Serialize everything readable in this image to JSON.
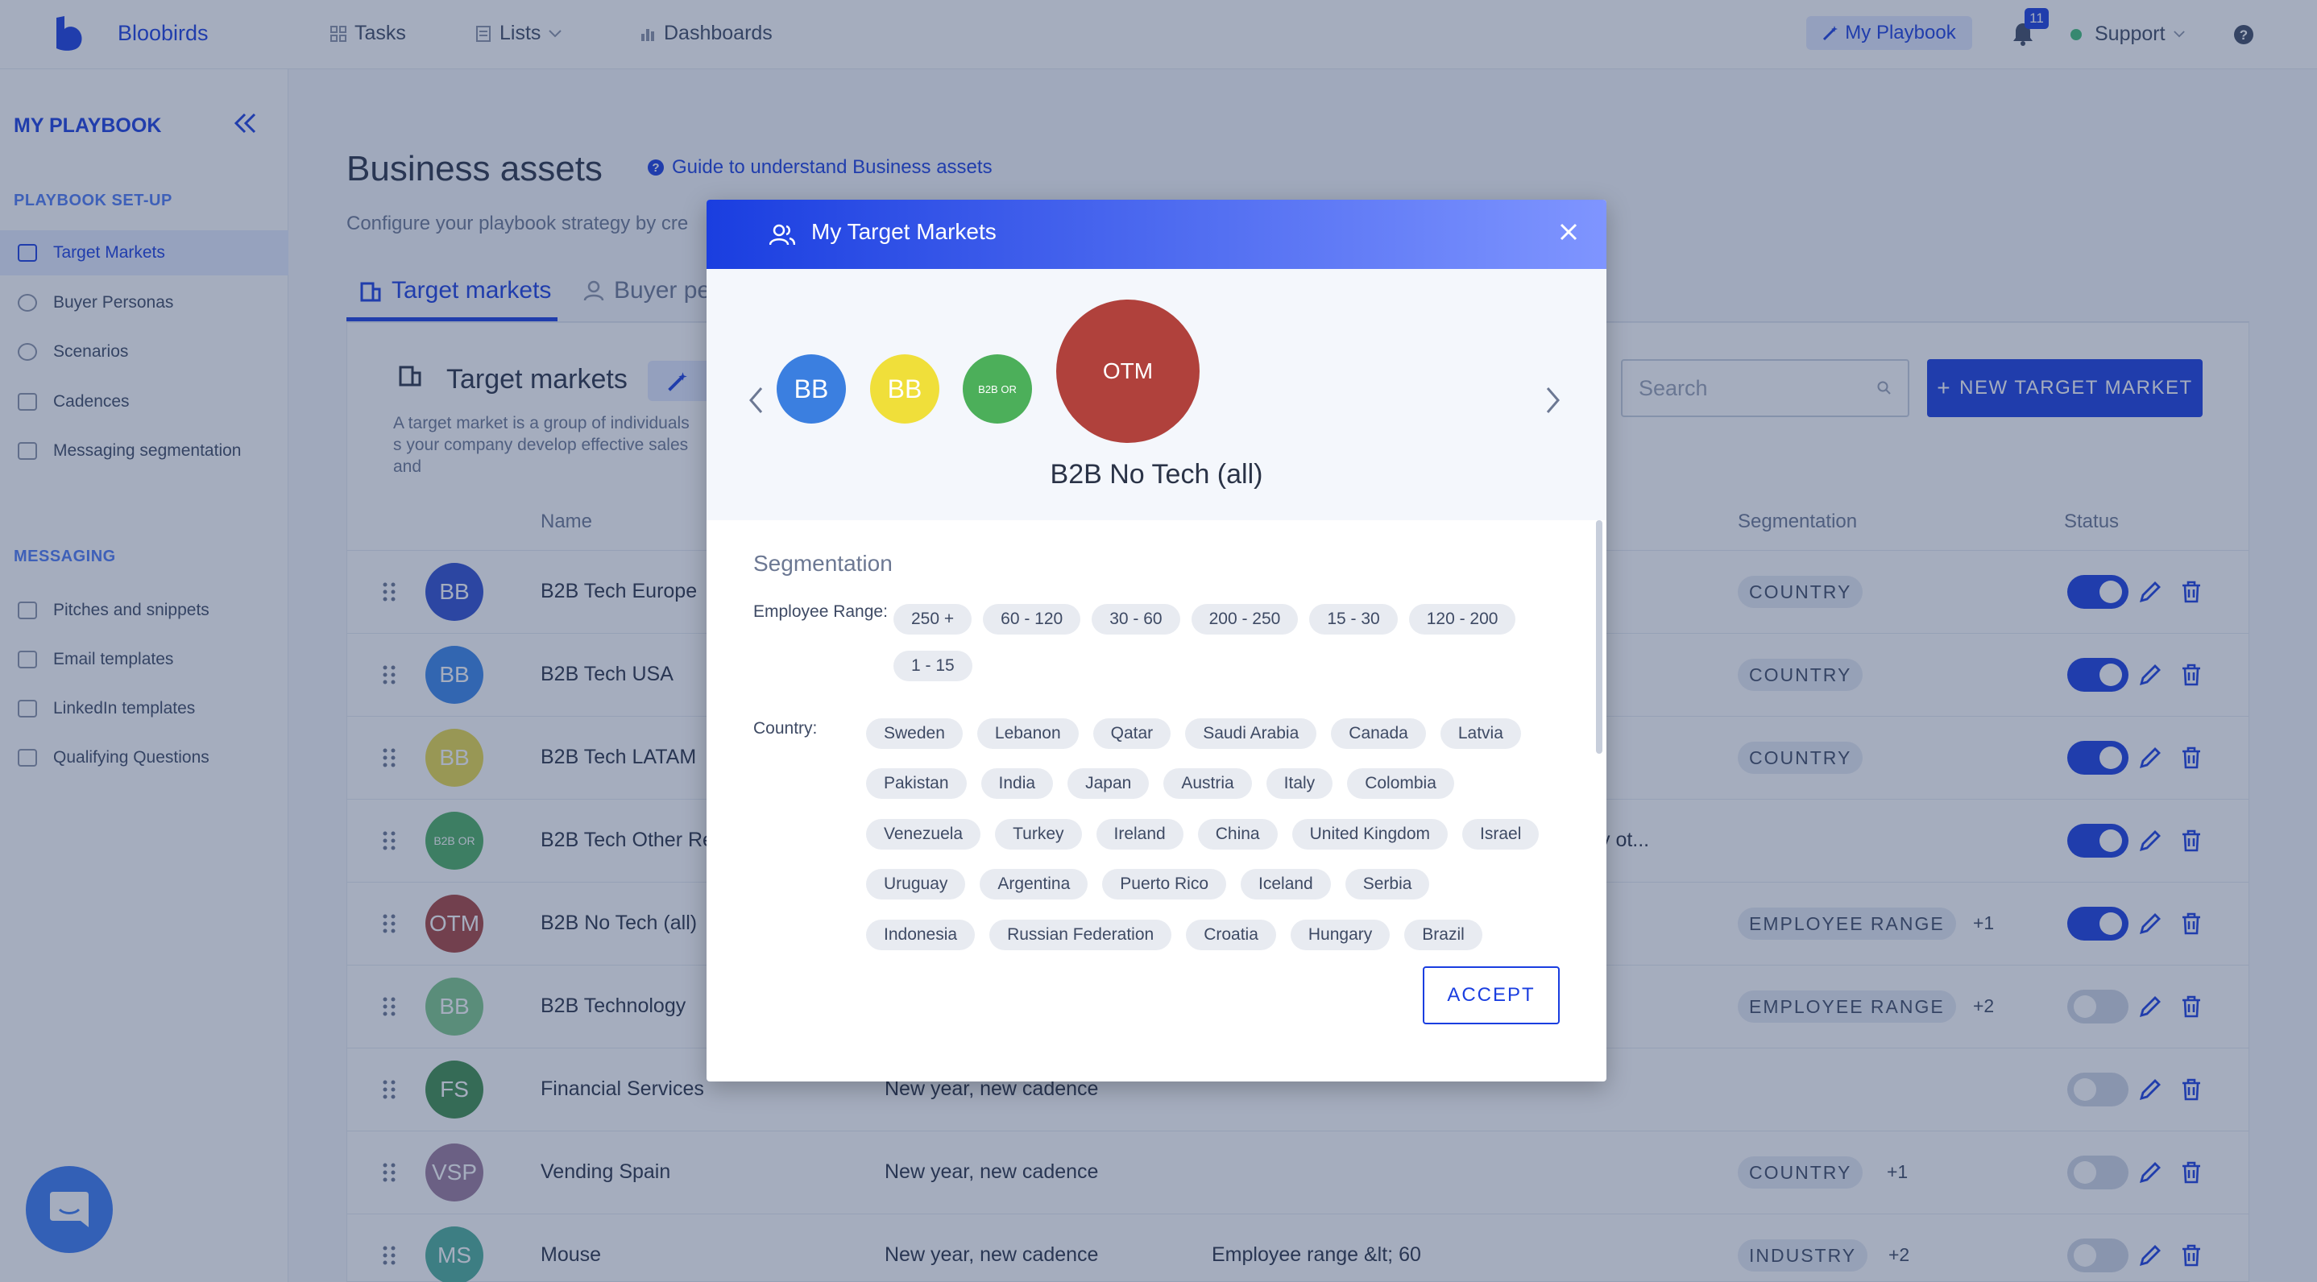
{
  "app": {
    "brand": "Bloobirds",
    "nav": {
      "tasks": "Tasks",
      "lists": "Lists",
      "dashboards": "Dashboards"
    },
    "my_playbook": "My Playbook",
    "notifications_count": "11",
    "support": "Support"
  },
  "sidebar": {
    "title": "MY PLAYBOOK",
    "section1": "PLAYBOOK SET-UP",
    "setup_items": [
      "Target Markets",
      "Buyer Personas",
      "Scenarios",
      "Cadences",
      "Messaging segmentation"
    ],
    "section2": "MESSAGING",
    "messaging_items": [
      "Pitches and snippets",
      "Email templates",
      "LinkedIn templates",
      "Qualifying Questions"
    ]
  },
  "main": {
    "title": "Business assets",
    "guide_link": "Guide to understand Business assets",
    "subtitle": "Configure your playbook strategy by cre",
    "tabs": [
      "Target markets",
      "Buyer pe"
    ],
    "panel_title": "Target markets",
    "panel_desc": "A target market is a group of individuals s your company develop effective sales and",
    "search_placeholder": "Search",
    "new_button": "NEW TARGET MARKET",
    "columns": {
      "name": "Name",
      "segmentation": "Segmentation",
      "status": "Status"
    },
    "rows": [
      {
        "initials": "BB",
        "name": "B2B Tech Europe",
        "cadence": "",
        "extra": "",
        "chip": "COUNTRY",
        "more": "",
        "enabled": true,
        "color": "#2f4fcf"
      },
      {
        "initials": "BB",
        "name": "B2B Tech USA",
        "cadence": "",
        "extra": "",
        "chip": "COUNTRY",
        "more": "",
        "enabled": true,
        "color": "#3a86e8"
      },
      {
        "initials": "BB",
        "name": "B2B Tech LATAM",
        "cadence": "",
        "extra": "",
        "chip": "COUNTRY",
        "more": "",
        "enabled": true,
        "color": "#e8d94a"
      },
      {
        "initials": "B2B OR",
        "name": "B2B Tech Other Re",
        "cadence": "",
        "extra": "y ot...",
        "chip": "",
        "more": "",
        "enabled": true,
        "color": "#4caf62"
      },
      {
        "initials": "OTM",
        "name": "B2B No Tech (all)",
        "cadence": "",
        "extra": "",
        "chip": "EMPLOYEE RANGE",
        "more": "+1",
        "enabled": true,
        "color": "#a8443e"
      },
      {
        "initials": "BB",
        "name": "B2B Technology",
        "cadence": "",
        "extra": "",
        "chip": "EMPLOYEE RANGE",
        "more": "+2",
        "enabled": false,
        "color": "#7fc88a"
      },
      {
        "initials": "FS",
        "name": "Financial Services",
        "cadence": "New year, new cadence",
        "extra": "",
        "chip": "",
        "more": "",
        "enabled": false,
        "color": "#3f8d4c"
      },
      {
        "initials": "VSP",
        "name": "Vending Spain",
        "cadence": "New year, new cadence",
        "extra": "",
        "chip": "COUNTRY",
        "more": "+1",
        "enabled": false,
        "color": "#9b7a9b"
      },
      {
        "initials": "MS",
        "name": "Mouse",
        "cadence": "New year, new cadence",
        "extra": "Employee range &lt; 60",
        "chip": "INDUSTRY",
        "more": "+2",
        "enabled": false,
        "color": "#4caf9a"
      }
    ]
  },
  "modal": {
    "title": "My Target Markets",
    "carousel": [
      {
        "initials": "BB",
        "color": "#3b7fe0"
      },
      {
        "initials": "BB",
        "color": "#f0df3a"
      },
      {
        "initials": "B2B OR",
        "color": "#4caf5a"
      },
      {
        "initials": "OTM",
        "color": "#b0413c"
      }
    ],
    "selected_name": "B2B No Tech (all)",
    "segmentation_title": "Segmentation",
    "employee_range_label": "Employee Range:",
    "employee_ranges": [
      "250 +",
      "60 - 120",
      "30 - 60",
      "200 - 250",
      "15 - 30",
      "120 - 200",
      "1 - 15"
    ],
    "country_label": "Country:",
    "countries": [
      "Sweden",
      "Lebanon",
      "Qatar",
      "Saudi Arabia",
      "Canada",
      "Latvia",
      "Pakistan",
      "India",
      "Japan",
      "Austria",
      "Italy",
      "Colombia",
      "Venezuela",
      "Turkey",
      "Ireland",
      "China",
      "United Kingdom",
      "Israel",
      "Uruguay",
      "Argentina",
      "Puerto Rico",
      "Iceland",
      "Serbia",
      "Indonesia",
      "Russian Federation",
      "Croatia",
      "Hungary",
      "Brazil"
    ],
    "accept": "ACCEPT"
  },
  "colors": {
    "accent": "#1a3ee0",
    "overlay": "rgba(40,60,100,0.42)"
  }
}
